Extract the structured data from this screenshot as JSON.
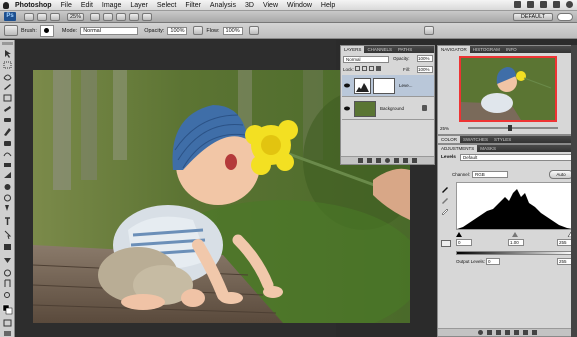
{
  "menubar": {
    "app": "Photoshop",
    "items": [
      "File",
      "Edit",
      "Image",
      "Layer",
      "Select",
      "Filter",
      "Analysis",
      "3D",
      "View",
      "Window",
      "Help"
    ]
  },
  "appbar": {
    "logo": "Ps",
    "zoom": "25%",
    "workspace": "DEFAULT"
  },
  "options": {
    "brush_label": "Brush:",
    "brush_size": "13",
    "mode_label": "Mode:",
    "mode_value": "Normal",
    "opacity_label": "Opacity:",
    "opacity_value": "100%",
    "flow_label": "Flow:",
    "flow_value": "100%"
  },
  "layers": {
    "tabs": [
      "LAYERS",
      "CHANNELS",
      "PATHS"
    ],
    "blend_mode": "Normal",
    "opacity_label": "Opacity:",
    "opacity_value": "100%",
    "lock_label": "Lock:",
    "fill_label": "Fill:",
    "fill_value": "100%",
    "rows": [
      {
        "name": "Leve..."
      },
      {
        "name": "Background"
      }
    ]
  },
  "navigator": {
    "tabs": [
      "NAVIGATOR",
      "HISTOGRAM",
      "INFO"
    ],
    "zoom": "25%"
  },
  "color_tabs": [
    "COLOR",
    "SWATCHES",
    "STYLES"
  ],
  "adjustments": {
    "tabs": [
      "ADJUSTMENTS",
      "MASKS"
    ],
    "title": "Levels",
    "preset": "Default",
    "channel_label": "Channel:",
    "channel": "RGB",
    "auto_label": "Auto",
    "input_black": "0",
    "input_gamma": "1.00",
    "input_white": "255",
    "output_label": "Output Levels:",
    "output_black": "0",
    "output_white": "255"
  }
}
